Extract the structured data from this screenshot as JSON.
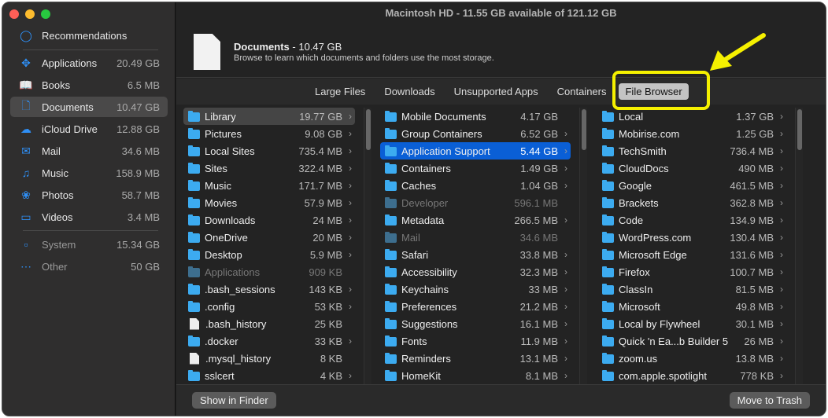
{
  "window_title": "Macintosh HD - 11.55 GB available of 121.12 GB",
  "sidebar": {
    "recommendations": "Recommendations",
    "items": [
      {
        "label": "Applications",
        "size": "20.49 GB",
        "icon": "appstore-icon"
      },
      {
        "label": "Books",
        "size": "6.5 MB",
        "icon": "book-icon"
      },
      {
        "label": "Documents",
        "size": "10.47 GB",
        "icon": "document-icon"
      },
      {
        "label": "iCloud Drive",
        "size": "12.88 GB",
        "icon": "cloud-icon"
      },
      {
        "label": "Mail",
        "size": "34.6 MB",
        "icon": "mail-icon"
      },
      {
        "label": "Music",
        "size": "158.9 MB",
        "icon": "music-icon"
      },
      {
        "label": "Photos",
        "size": "58.7 MB",
        "icon": "photos-icon"
      },
      {
        "label": "Videos",
        "size": "3.4 MB",
        "icon": "tv-icon"
      }
    ],
    "other_items": [
      {
        "label": "System",
        "size": "15.34 GB",
        "icon": "laptop-icon"
      },
      {
        "label": "Other",
        "size": "50 GB",
        "icon": "ellipsis-icon"
      }
    ]
  },
  "header": {
    "title": "Documents",
    "size": " - 10.47 GB",
    "subtitle": "Browse to learn which documents and folders use the most storage."
  },
  "tabs": [
    "Large Files",
    "Downloads",
    "Unsupported Apps",
    "Containers",
    "File Browser"
  ],
  "columns": [
    [
      [
        "Library",
        "19.77 GB",
        "f",
        "hl",
        1
      ],
      [
        "Pictures",
        "9.08 GB",
        "f",
        "",
        1
      ],
      [
        "Local Sites",
        "735.4 MB",
        "f",
        "",
        1
      ],
      [
        "Sites",
        "322.4 MB",
        "f",
        "",
        1
      ],
      [
        "Music",
        "171.7 MB",
        "f",
        "",
        1
      ],
      [
        "Movies",
        "57.9 MB",
        "f",
        "",
        1
      ],
      [
        "Downloads",
        "24 MB",
        "f",
        "",
        1
      ],
      [
        "OneDrive",
        "20 MB",
        "f",
        "",
        1
      ],
      [
        "Desktop",
        "5.9 MB",
        "f",
        "",
        1
      ],
      [
        "Applications",
        "909 KB",
        "f",
        "dim",
        0
      ],
      [
        ".bash_sessions",
        "143 KB",
        "f",
        "",
        1
      ],
      [
        ".config",
        "53 KB",
        "f",
        "",
        1
      ],
      [
        ".bash_history",
        "25 KB",
        "d",
        "",
        0
      ],
      [
        ".docker",
        "33 KB",
        "f",
        "",
        1
      ],
      [
        ".mysql_history",
        "8 KB",
        "d",
        "",
        0
      ],
      [
        "sslcert",
        "4 KB",
        "f",
        "",
        1
      ]
    ],
    [
      [
        "Mobile Documents",
        "4.17 GB",
        "f",
        "",
        0
      ],
      [
        "Group Containers",
        "6.52 GB",
        "f",
        "",
        1
      ],
      [
        "Application Support",
        "5.44 GB",
        "f",
        "sel",
        1
      ],
      [
        "Containers",
        "1.49 GB",
        "f",
        "",
        1
      ],
      [
        "Caches",
        "1.04 GB",
        "f",
        "",
        1
      ],
      [
        "Developer",
        "596.1 MB",
        "f",
        "dim",
        0
      ],
      [
        "Metadata",
        "266.5 MB",
        "f",
        "",
        1
      ],
      [
        "Mail",
        "34.6 MB",
        "f",
        "dim",
        0
      ],
      [
        "Safari",
        "33.8 MB",
        "f",
        "",
        1
      ],
      [
        "Accessibility",
        "32.3 MB",
        "f",
        "",
        1
      ],
      [
        "Keychains",
        "33 MB",
        "f",
        "",
        1
      ],
      [
        "Preferences",
        "21.2 MB",
        "f",
        "",
        1
      ],
      [
        "Suggestions",
        "16.1 MB",
        "f",
        "",
        1
      ],
      [
        "Fonts",
        "11.9 MB",
        "f",
        "",
        1
      ],
      [
        "Reminders",
        "13.1 MB",
        "f",
        "",
        1
      ],
      [
        "HomeKit",
        "8.1 MB",
        "f",
        "",
        1
      ]
    ],
    [
      [
        "Local",
        "1.37 GB",
        "f",
        "",
        1
      ],
      [
        "Mobirise.com",
        "1.25 GB",
        "f",
        "",
        1
      ],
      [
        "TechSmith",
        "736.4 MB",
        "f",
        "",
        1
      ],
      [
        "CloudDocs",
        "490 MB",
        "f",
        "",
        1
      ],
      [
        "Google",
        "461.5 MB",
        "f",
        "",
        1
      ],
      [
        "Brackets",
        "362.8 MB",
        "f",
        "",
        1
      ],
      [
        "Code",
        "134.9 MB",
        "f",
        "",
        1
      ],
      [
        "WordPress.com",
        "130.4 MB",
        "f",
        "",
        1
      ],
      [
        "Microsoft Edge",
        "131.6 MB",
        "f",
        "",
        1
      ],
      [
        "Firefox",
        "100.7 MB",
        "f",
        "",
        1
      ],
      [
        "ClassIn",
        "81.5 MB",
        "f",
        "",
        1
      ],
      [
        "Microsoft",
        "49.8 MB",
        "f",
        "",
        1
      ],
      [
        "Local by Flywheel",
        "30.1 MB",
        "f",
        "",
        1
      ],
      [
        "Quick 'n Ea...b Builder 5",
        "26 MB",
        "f",
        "",
        1
      ],
      [
        "zoom.us",
        "13.8 MB",
        "f",
        "",
        1
      ],
      [
        "com.apple.spotlight",
        "778 KB",
        "f",
        "",
        1
      ]
    ]
  ],
  "footer": {
    "show_in_finder": "Show in Finder",
    "move_to_trash": "Move to Trash"
  },
  "colors": {
    "accent": "#0a5fd6",
    "folder": "#3cabf0",
    "annotation": "#f5f000"
  }
}
